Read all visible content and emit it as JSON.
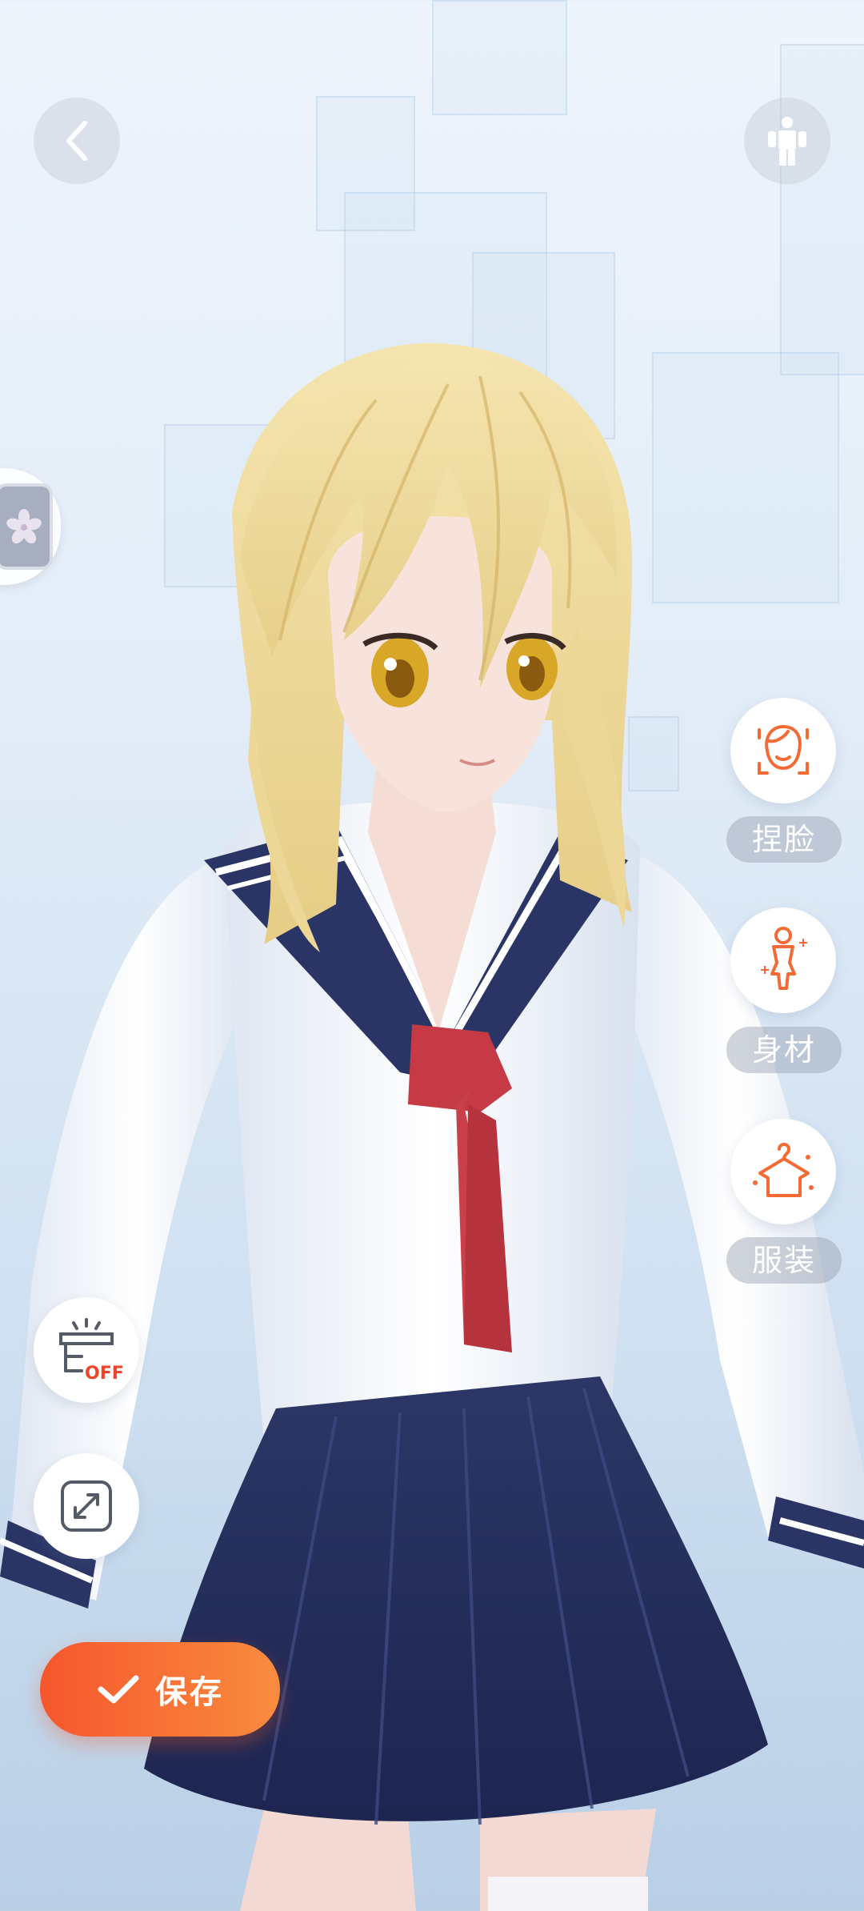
{
  "header": {
    "back_icon": "chevron-left-icon",
    "pose_icon": "standing-figure-icon"
  },
  "left_tab": {
    "icon": "cherry-blossom-icon"
  },
  "right_menu": {
    "items": [
      {
        "icon": "face-sculpt-icon",
        "label": "捏脸"
      },
      {
        "icon": "body-shape-icon",
        "label": "身材"
      },
      {
        "icon": "outfit-hanger-icon",
        "label": "服装"
      }
    ]
  },
  "tools": {
    "light_toggle_icon": "spotlight-icon",
    "light_toggle_state": "OFF",
    "fullscreen_icon": "expand-arrows-icon"
  },
  "save": {
    "label": "保存",
    "icon": "check-icon"
  },
  "colors": {
    "accent_orange": "#f36a35",
    "save_gradient_start": "#f6562c",
    "save_gradient_end": "#f98c3f",
    "label_bg": "#969faf"
  }
}
